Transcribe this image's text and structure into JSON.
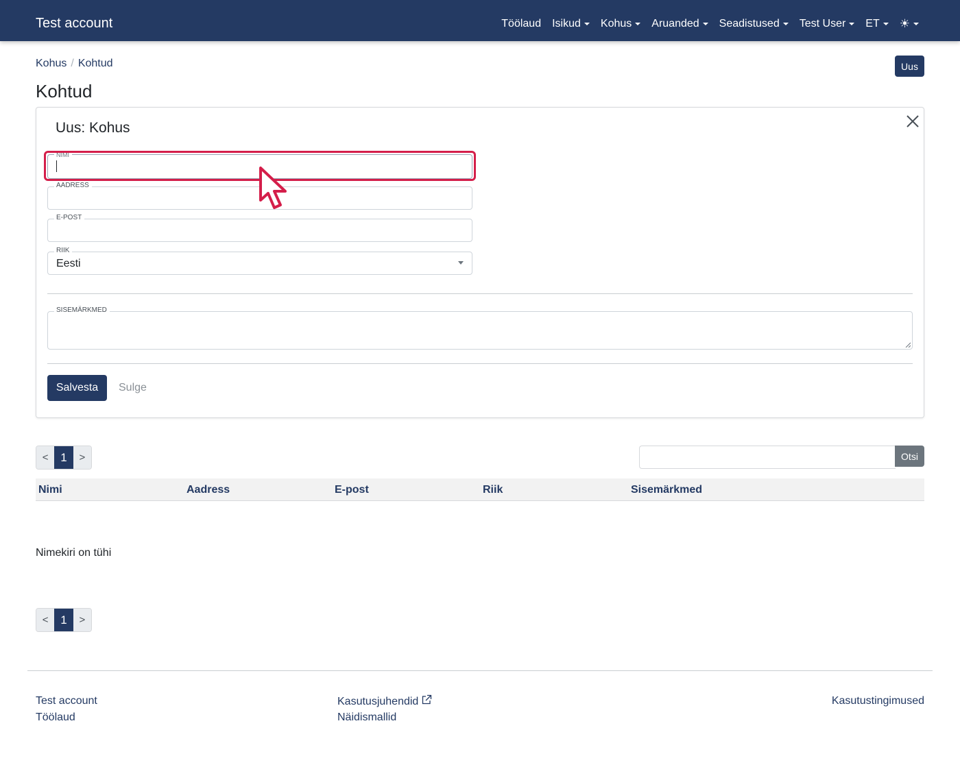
{
  "navbar": {
    "brand": "Test account",
    "items": [
      {
        "label": "Töölaud",
        "dropdown": false
      },
      {
        "label": "Isikud",
        "dropdown": true
      },
      {
        "label": "Kohus",
        "dropdown": true
      },
      {
        "label": "Aruanded",
        "dropdown": true
      },
      {
        "label": "Seadistused",
        "dropdown": true
      },
      {
        "label": "Test User",
        "dropdown": true
      },
      {
        "label": "ET",
        "dropdown": true
      }
    ],
    "theme_icon": "☀"
  },
  "breadcrumb": [
    {
      "label": "Kohus"
    },
    {
      "label": "Kohtud"
    }
  ],
  "new_button": "Uus",
  "page_title": "Kohtud",
  "form": {
    "title": "Uus: Kohus",
    "fields": {
      "name": {
        "label": "Nimi",
        "value": ""
      },
      "address": {
        "label": "Aadress",
        "value": ""
      },
      "email": {
        "label": "E-post",
        "value": ""
      },
      "country": {
        "label": "Riik",
        "value": "Eesti"
      },
      "notes": {
        "label": "Sisemärkmed",
        "value": ""
      }
    },
    "save_label": "Salvesta",
    "close_label": "Sulge"
  },
  "pager": {
    "prev": "<",
    "current": "1",
    "next": ">"
  },
  "search": {
    "placeholder": "",
    "button": "Otsi"
  },
  "table": {
    "columns": [
      "Nimi",
      "Aadress",
      "E-post",
      "Riik",
      "Sisemärkmed"
    ],
    "rows": [],
    "empty_message": "Nimekiri on tühi"
  },
  "footer": {
    "brand": "Test account",
    "dashboard": "Töölaud",
    "manuals": "Kasutusjuhendid",
    "templates": "Näidismallid",
    "terms": "Kasutustingimused"
  },
  "colors": {
    "navbar": "#243a63",
    "primary": "#243a63",
    "focus_highlight": "#d41e4a",
    "secondary": "#6c757d"
  }
}
